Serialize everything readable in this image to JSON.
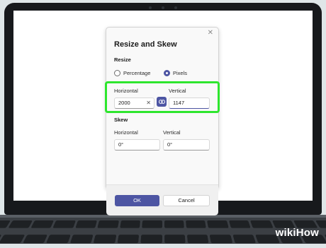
{
  "dialog": {
    "title": "Resize and Skew",
    "close_icon": "close-icon",
    "resize": {
      "label": "Resize",
      "options": [
        {
          "label": "Percentage",
          "selected": false
        },
        {
          "label": "Pixels",
          "selected": true
        }
      ],
      "horizontal_label": "Horizontal",
      "horizontal_value": "2000",
      "vertical_label": "Vertical",
      "vertical_value": "1147",
      "clear_glyph": "✕",
      "link_icon": "link-icon"
    },
    "skew": {
      "label": "Skew",
      "horizontal_label": "Horizontal",
      "horizontal_value": "0°",
      "vertical_label": "Vertical",
      "vertical_value": "0°"
    },
    "ok_label": "OK",
    "cancel_label": "Cancel"
  },
  "highlight_color": "#2ee62e",
  "accent_color": "#4d55a3",
  "watermark": {
    "prefix": "wiki",
    "suffix": "How"
  }
}
